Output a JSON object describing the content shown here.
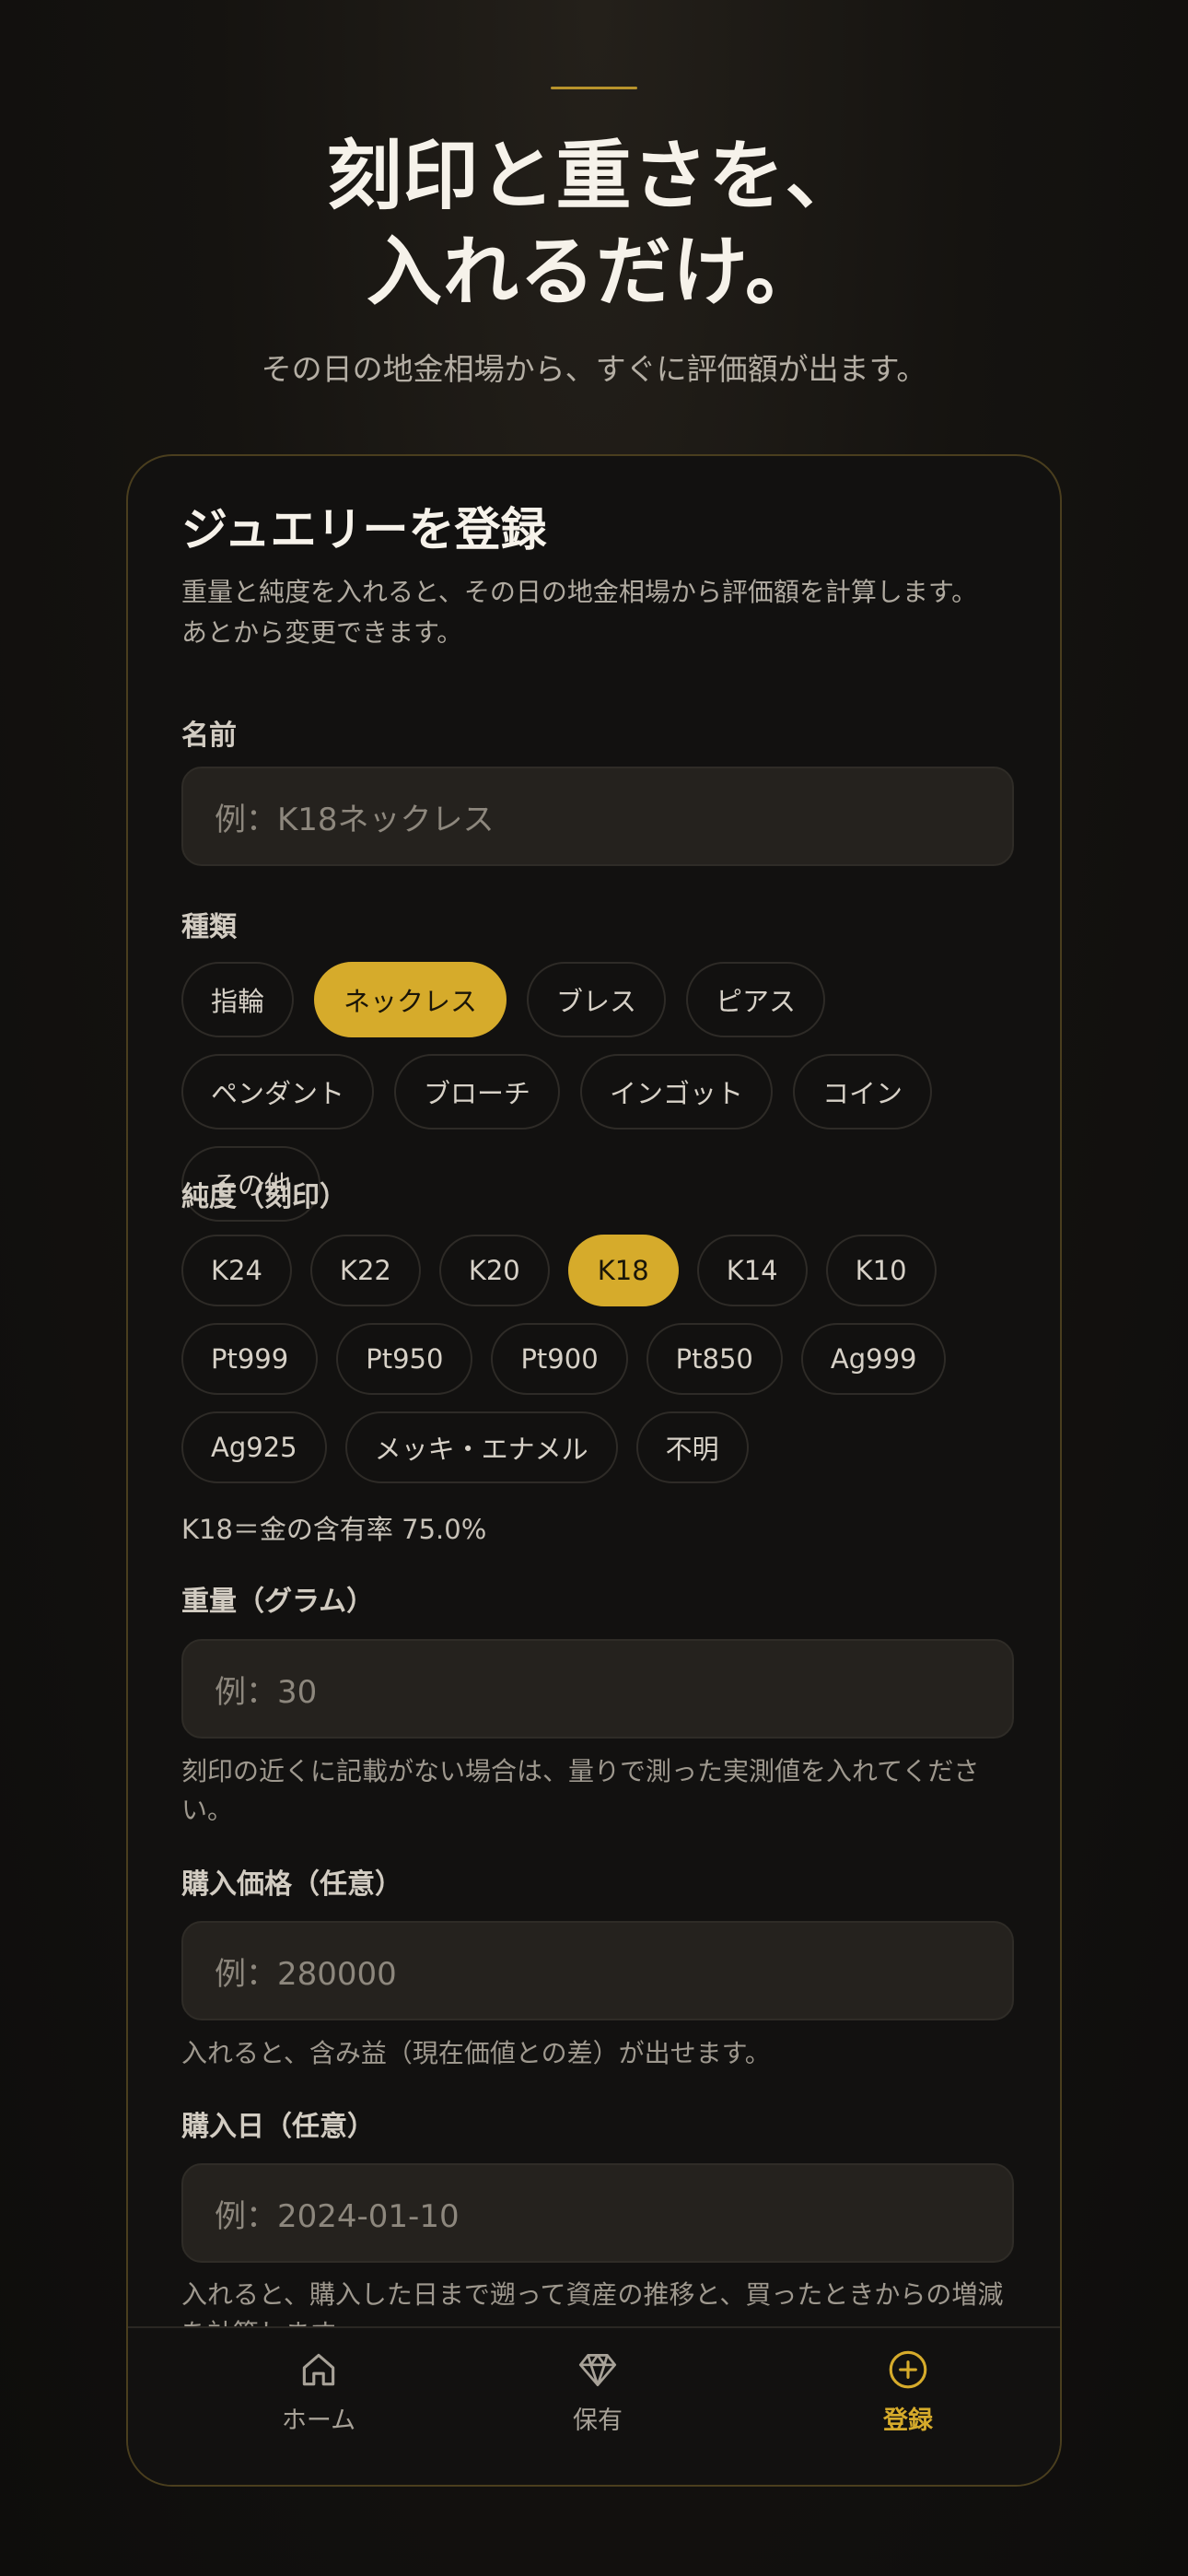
{
  "hero": {
    "title_line1": "刻印と重さを、",
    "title_line2": "入れるだけ。",
    "subtitle": "その日の地金相場から、すぐに評価額が出ます。"
  },
  "form": {
    "title": "ジュエリーを登録",
    "desc_line1": "重量と純度を入れると、その日の地金相場から評価額を計算します。",
    "desc_line2": "あとから変更できます。",
    "name": {
      "label": "名前",
      "placeholder": "例：K18ネックレス"
    },
    "type": {
      "label": "種類",
      "options": [
        "指輪",
        "ネックレス",
        "ブレス",
        "ピアス",
        "ペンダント",
        "ブローチ",
        "インゴット",
        "コイン",
        "その他"
      ],
      "selected": "ネックレス"
    },
    "purity": {
      "label": "純度（刻印）",
      "options": [
        "K24",
        "K22",
        "K20",
        "K18",
        "K14",
        "K10",
        "Pt999",
        "Pt950",
        "Pt900",
        "Pt850",
        "Ag999",
        "Ag925",
        "メッキ・エナメル",
        "不明"
      ],
      "selected": "K18",
      "note": "K18＝金の含有率 75.0%"
    },
    "weight": {
      "label": "重量（グラム）",
      "placeholder": "例：30",
      "help": "刻印の近くに記載がない場合は、量りで測った実測値を入れてください。"
    },
    "price": {
      "label": "購入価格（任意）",
      "placeholder": "例：280000",
      "help": "入れると、含み益（現在価値との差）が出せます。"
    },
    "date": {
      "label": "購入日（任意）",
      "placeholder": "例：2024-01-10",
      "help": "入れると、購入した日まで遡って資産の推移と、買ったときからの増減を計算します。"
    }
  },
  "nav": {
    "items": [
      {
        "label": "ホーム",
        "icon": "home-icon"
      },
      {
        "label": "保有",
        "icon": "gem-icon"
      },
      {
        "label": "登録",
        "icon": "plus-circle-icon"
      }
    ],
    "active": "登録"
  },
  "colors": {
    "accent": "#d6ab2b",
    "background": "#121110",
    "field": "#25221e"
  }
}
